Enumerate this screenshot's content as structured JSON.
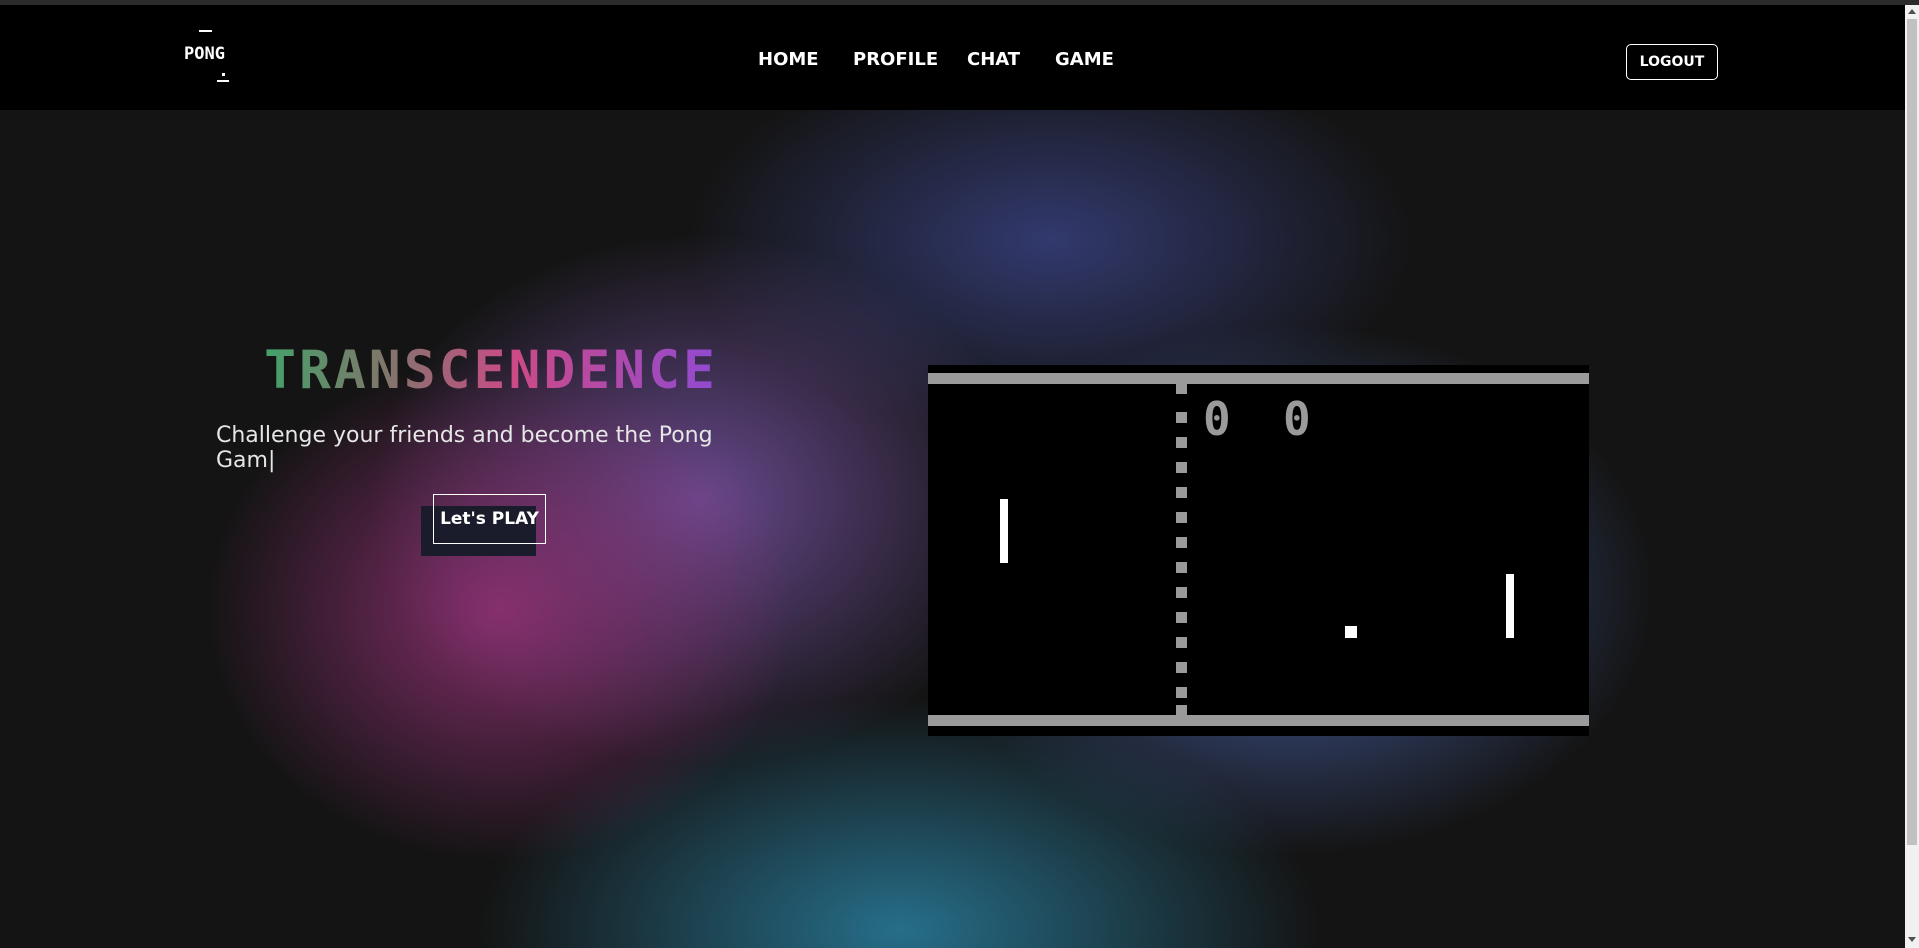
{
  "logo": {
    "text": "PONG"
  },
  "nav": {
    "home": "HOME",
    "profile": "PROFILE",
    "chat": "CHAT",
    "game": "GAME",
    "logout": "LOGOUT"
  },
  "hero": {
    "title": "TRANSCENDENCE",
    "tagline": "Challenge your friends and become the Pong Gam|",
    "play_label": "Let's PLAY"
  },
  "game_preview": {
    "score_left": "0",
    "score_right": "0"
  },
  "colors": {
    "title_gradient": [
      "#3fa56a",
      "#7a7a6a",
      "#cc4a86",
      "#8e4ad4"
    ],
    "court_lines": "#9a9a9a"
  }
}
